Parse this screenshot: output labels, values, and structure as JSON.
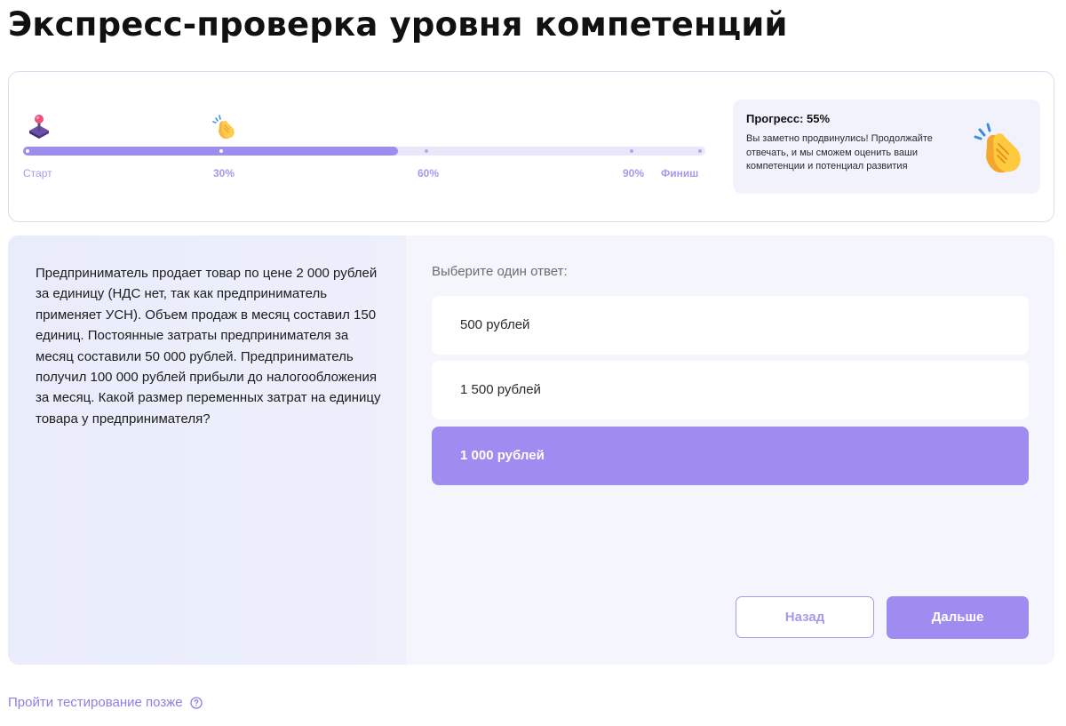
{
  "page": {
    "title": "Экспресс-проверка уровня компетенций"
  },
  "progress": {
    "value_percent": 55,
    "milestones": [
      {
        "label": "Старт"
      },
      {
        "label": "30%"
      },
      {
        "label": "60%"
      },
      {
        "label": "90%"
      },
      {
        "label": "Финиш"
      }
    ],
    "info_title": "Прогресс: 55%",
    "info_text": "Вы заметно продвинулись! Продолжайте отвечать, и мы сможем оценить ваши компетенции и потенциал развития",
    "icons": [
      "pin-icon",
      "clapping-hands-icon"
    ],
    "colors": {
      "accent": "#9e8cf0",
      "track": "#e9e8fb",
      "label": "#a898ee"
    }
  },
  "question": {
    "text": "Предприниматель продает товар по цене 2 000 рублей за единицу (НДС нет, так как предприниматель применяет УСН). Объем продаж в месяц составил 150 единиц. Постоянные затраты предпринимателя за месяц составили 50 000 рублей. Предприниматель получил 100 000 рублей прибыли до налогообложения за месяц. Какой размер переменных затрат на единицу товара у предпринимателя?",
    "prompt": "Выберите один ответ:",
    "options": [
      {
        "label": "500 рублей",
        "selected": false
      },
      {
        "label": "1 500 рублей",
        "selected": false
      },
      {
        "label": "1 000 рублей",
        "selected": true
      }
    ]
  },
  "actions": {
    "back_label": "Назад",
    "next_label": "Дальше"
  },
  "footer": {
    "later_label": "Пройти тестирование позже",
    "help_icon": "question-circle-icon"
  }
}
